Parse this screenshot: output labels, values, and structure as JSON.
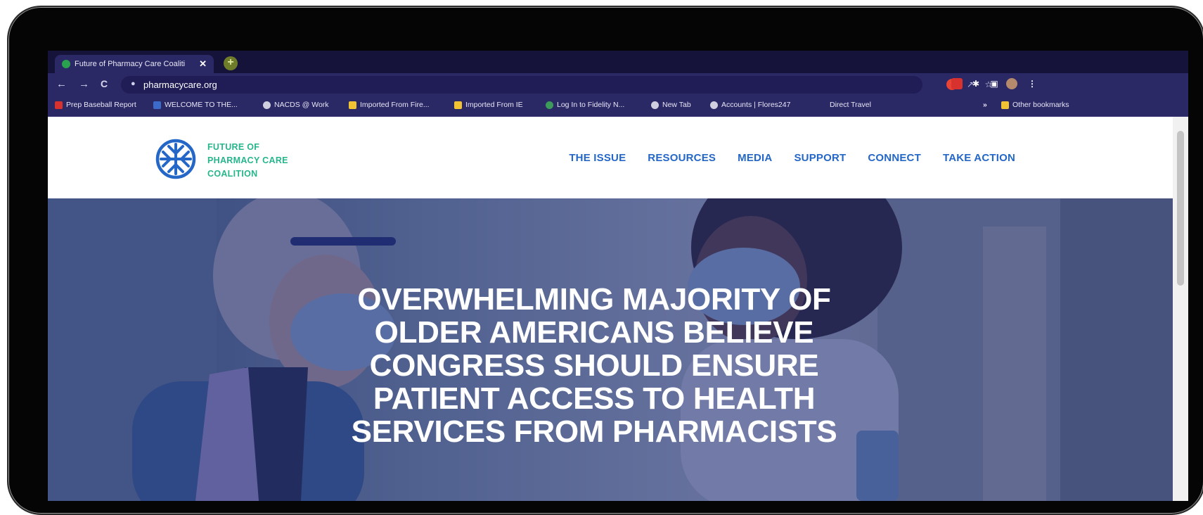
{
  "browser": {
    "tab": {
      "title": "Future of Pharmacy Care Coaliti",
      "close": "✕"
    },
    "new_tab": "+",
    "nav": {
      "back": "←",
      "forward": "→",
      "reload": "C"
    },
    "url": "pharmacycare.org",
    "lock_icon": "🔒",
    "bookmarks": [
      {
        "label": "Prep Baseball Report",
        "icon_color": "#d8322f"
      },
      {
        "label": "WELCOME TO THE...",
        "icon_color": "#3b6ac8"
      },
      {
        "label": "NACDS @ Work",
        "icon_color": "#cfcfe0"
      },
      {
        "label": "Imported From Fire...",
        "icon_color": "#f1c232"
      },
      {
        "label": "Imported From IE",
        "icon_color": "#f1c232"
      },
      {
        "label": "Log In to Fidelity N...",
        "icon_color": "#3c9a5b"
      },
      {
        "label": "New Tab",
        "icon_color": "#cfcfe0"
      },
      {
        "label": "Accounts | Flores247",
        "icon_color": "#cfcfe0"
      },
      {
        "label": "Direct Travel",
        "icon_color": "transparent"
      }
    ],
    "other_bookmarks": "Other bookmarks",
    "overflow": "»"
  },
  "site": {
    "logo_lines": [
      "FUTURE OF",
      "PHARMACY CARE",
      "COALITION"
    ],
    "menu": [
      "THE ISSUE",
      "RESOURCES",
      "MEDIA",
      "SUPPORT",
      "CONNECT",
      "TAKE ACTION"
    ],
    "hero_title": "OVERWHELMING MAJORITY OF\nOLDER AMERICANS BELIEVE\nCONGRESS SHOULD ENSURE\nPATIENT ACCESS TO HEALTH\nSERVICES FROM PHARMACISTS"
  },
  "colors": {
    "accent_green": "#27b58c",
    "nav_blue": "#2467c6",
    "chrome_purple": "#2b2866"
  }
}
